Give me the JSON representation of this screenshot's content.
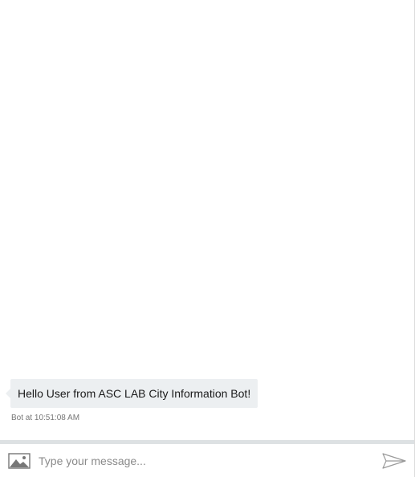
{
  "conversation": {
    "messages": [
      {
        "text": "Hello User from ASC LAB City Information Bot!",
        "meta": "Bot at 10:51:08 AM"
      }
    ]
  },
  "composer": {
    "placeholder": "Type your message...",
    "upload_icon": "image-upload-icon",
    "send_icon": "send-icon"
  },
  "colors": {
    "bubble_background": "#eceff1",
    "divider": "#dde1e3",
    "timestamp": "#767676",
    "icon": "#8a8a8a"
  }
}
